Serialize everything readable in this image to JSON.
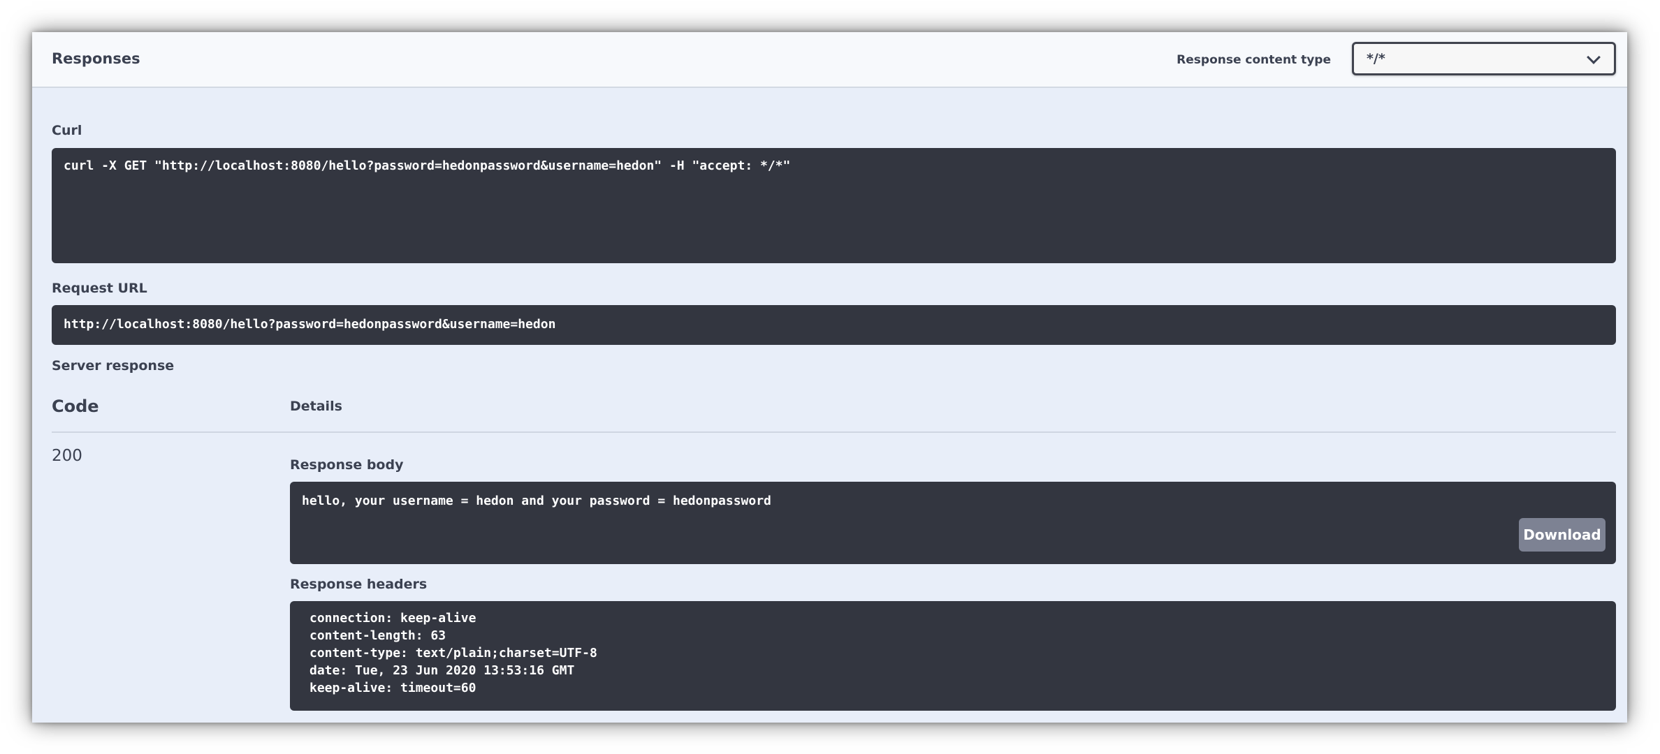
{
  "responses": {
    "title": "Responses",
    "content_type_label": "Response content type",
    "content_type_value": "*/*"
  },
  "curl": {
    "label": "Curl",
    "command": "curl -X GET \"http://localhost:8080/hello?password=hedonpassword&username=hedon\" -H \"accept: */*\""
  },
  "request_url": {
    "label": "Request URL",
    "value": "http://localhost:8080/hello?password=hedonpassword&username=hedon"
  },
  "server_response": {
    "label": "Server response",
    "col_code": "Code",
    "col_details": "Details",
    "code": "200",
    "body_label": "Response body",
    "body": "hello, your username = hedon and your password = hedonpassword",
    "download_label": "Download",
    "headers_label": "Response headers",
    "headers": [
      "connection: keep-alive",
      "content-length: 63",
      "content-type: text/plain;charset=UTF-8",
      "date: Tue, 23 Jun 2020 13:53:16 GMT",
      "keep-alive: timeout=60"
    ]
  }
}
